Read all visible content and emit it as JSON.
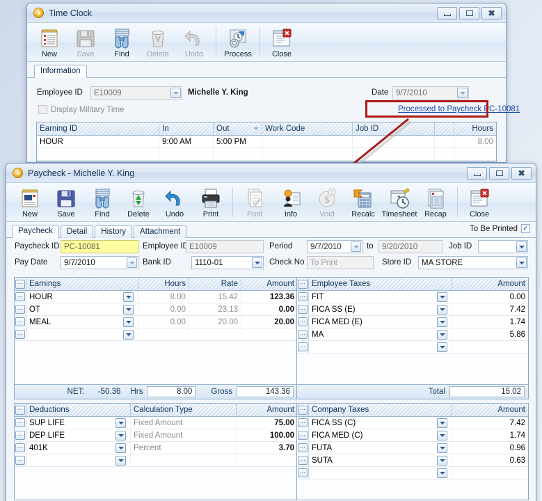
{
  "desktop": {
    "annotation_arrow": "red-arrow-pointer"
  },
  "timeclock": {
    "title": "Time Clock",
    "window_buttons": {
      "minimize": "minimize-icon",
      "maximize": "maximize-icon",
      "close": "close-icon"
    },
    "toolbar": [
      {
        "label": "New",
        "icon": "new-document-icon",
        "enabled": true
      },
      {
        "label": "Save",
        "icon": "floppy-disk-icon",
        "enabled": false
      },
      {
        "label": "Find",
        "icon": "binoculars-icon",
        "enabled": true
      },
      {
        "label": "Delete",
        "icon": "trash-can-icon",
        "enabled": false
      },
      {
        "label": "Undo",
        "icon": "undo-arrow-icon",
        "enabled": false
      },
      {
        "label": "Process",
        "icon": "gear-clock-icon",
        "enabled": true
      },
      {
        "label": "Close",
        "icon": "close-window-icon",
        "enabled": true
      }
    ],
    "tabs": [
      {
        "label": "Information",
        "active": true
      }
    ],
    "form": {
      "employee_id_label": "Employee ID",
      "employee_id_value": "E10009",
      "employee_name": "Michelle Y. King",
      "date_label": "Date",
      "date_value": "9/7/2010",
      "military_time_label": "Display Military Time",
      "military_time_checked": false,
      "processed_link": "Processed to Paycheck PC-10081"
    },
    "grid": {
      "columns": [
        "Earning ID",
        "In",
        "Out",
        "Work Code",
        "Job ID",
        "Hours"
      ],
      "rows": [
        {
          "earning_id": "HOUR",
          "in": "9:00 AM",
          "out": "5:00 PM",
          "work_code": "",
          "job_id": "",
          "hours": "8.00"
        },
        {
          "earning_id": "",
          "in": "",
          "out": "",
          "work_code": "",
          "job_id": "",
          "hours": ""
        }
      ]
    }
  },
  "paycheck": {
    "title": "Paycheck - Michelle Y. King",
    "window_buttons": {
      "minimize": "minimize-icon",
      "maximize": "maximize-icon",
      "close": "close-icon"
    },
    "toolbar": [
      {
        "label": "New",
        "icon": "new-document-icon",
        "enabled": true
      },
      {
        "label": "Save",
        "icon": "floppy-disk-icon",
        "enabled": true
      },
      {
        "label": "Find",
        "icon": "binoculars-icon",
        "enabled": true
      },
      {
        "label": "Delete",
        "icon": "trash-can-icon",
        "enabled": true
      },
      {
        "label": "Undo",
        "icon": "undo-arrow-icon",
        "enabled": true
      },
      {
        "label": "Print",
        "icon": "printer-icon",
        "enabled": true
      },
      {
        "label": "Post",
        "icon": "post-checklist-icon",
        "enabled": false
      },
      {
        "label": "Info",
        "icon": "info-person-icon",
        "enabled": true
      },
      {
        "label": "Void",
        "icon": "void-dollar-icon",
        "enabled": false
      },
      {
        "label": "Recalc",
        "icon": "calculator-icon",
        "enabled": true
      },
      {
        "label": "Timesheet",
        "icon": "timesheet-clock-icon",
        "enabled": true
      },
      {
        "label": "Recap",
        "icon": "recap-report-icon",
        "enabled": true
      },
      {
        "label": "Close",
        "icon": "close-window-icon",
        "enabled": true
      }
    ],
    "tabs": [
      {
        "label": "Paycheck",
        "active": true
      },
      {
        "label": "Detail",
        "active": false
      },
      {
        "label": "History",
        "active": false
      },
      {
        "label": "Attachment",
        "active": false
      }
    ],
    "to_be_printed_label": "To Be Printed",
    "to_be_printed_checked": true,
    "form": {
      "paycheck_id_label": "Paycheck ID",
      "paycheck_id_value": "PC-10081",
      "employee_id_label": "Employee ID",
      "employee_id_value": "E10009",
      "period_label": "Period",
      "period_from": "9/7/2010",
      "period_to_label": "to",
      "period_to": "9/20/2010",
      "job_id_label": "Job ID",
      "job_id_value": "",
      "pay_date_label": "Pay Date",
      "pay_date_value": "9/7/2010",
      "bank_id_label": "Bank ID",
      "bank_id_value": "1110-01",
      "check_no_label": "Check No",
      "check_no_placeholder": "To Print",
      "store_id_label": "Store ID",
      "store_id_value": "MA STORE"
    },
    "earnings": {
      "columns": [
        "Earnings",
        "Hours",
        "Rate",
        "Amount"
      ],
      "rows": [
        {
          "name": "HOUR",
          "hours": "8.00",
          "rate": "15.42",
          "amount": "123.36"
        },
        {
          "name": "OT",
          "hours": "0.00",
          "rate": "23.13",
          "amount": "0.00"
        },
        {
          "name": "MEAL",
          "hours": "0.00",
          "rate": "20.00",
          "amount": "20.00"
        },
        {
          "name": "",
          "hours": "",
          "rate": "",
          "amount": ""
        }
      ],
      "footer": {
        "net_label": "NET:",
        "net_value": "-50.36",
        "hrs_label": "Hrs",
        "hrs_value": "8.00",
        "gross_label": "Gross",
        "gross_value": "143.36"
      }
    },
    "employee_taxes": {
      "columns": [
        "Employee Taxes",
        "Amount"
      ],
      "rows": [
        {
          "name": "FIT",
          "amount": "0.00"
        },
        {
          "name": "FICA SS (E)",
          "amount": "7.42"
        },
        {
          "name": "FICA MED (E)",
          "amount": "1.74"
        },
        {
          "name": "MA",
          "amount": "5.86"
        },
        {
          "name": "",
          "amount": ""
        }
      ],
      "footer": {
        "total_label": "Total",
        "total_value": "15.02"
      }
    },
    "deductions": {
      "columns": [
        "Deductions",
        "Calculation Type",
        "Amount"
      ],
      "rows": [
        {
          "name": "SUP LIFE",
          "calc": "Fixed Amount",
          "amount": "75.00"
        },
        {
          "name": "DEP LIFE",
          "calc": "Fixed Amount",
          "amount": "100.00"
        },
        {
          "name": "401K",
          "calc": "Percent",
          "amount": "3.70"
        },
        {
          "name": "",
          "calc": "",
          "amount": ""
        }
      ]
    },
    "company_taxes": {
      "columns": [
        "Company Taxes",
        "Amount"
      ],
      "rows": [
        {
          "name": "FICA SS (C)",
          "amount": "7.42"
        },
        {
          "name": "FICA MED (C)",
          "amount": "1.74"
        },
        {
          "name": "FUTA",
          "amount": "0.96"
        },
        {
          "name": "SUTA",
          "amount": "0.63"
        },
        {
          "name": "",
          "amount": ""
        }
      ]
    }
  }
}
